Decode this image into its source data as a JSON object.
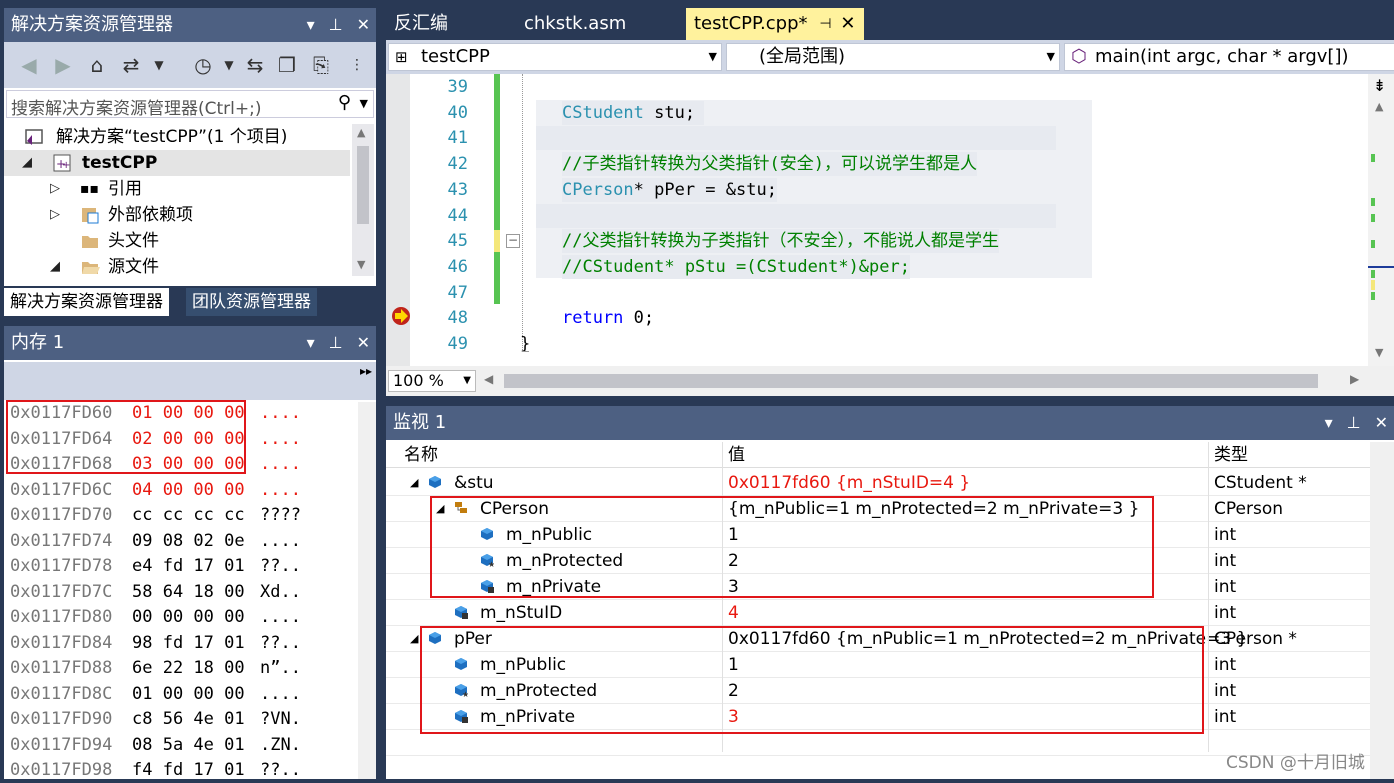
{
  "solution_explorer": {
    "title": "解决方案资源管理器",
    "search_placeholder": "搜索解决方案资源管理器(Ctrl+;)",
    "tree": {
      "solution": "解决方案“testCPP”(1 个项目)",
      "project": "testCPP",
      "references": "引用",
      "external_deps": "外部依赖项",
      "headers": "头文件",
      "sources": "源文件"
    },
    "bottom_tabs": [
      "解决方案资源管理器",
      "团队资源管理器"
    ]
  },
  "memory": {
    "title": "内存 1",
    "rows": [
      {
        "addr": "0x0117FD60",
        "bytes": "01 00 00 00",
        "ascii": "....",
        "changed": true
      },
      {
        "addr": "0x0117FD64",
        "bytes": "02 00 00 00",
        "ascii": "....",
        "changed": true
      },
      {
        "addr": "0x0117FD68",
        "bytes": "03 00 00 00",
        "ascii": "....",
        "changed": true
      },
      {
        "addr": "0x0117FD6C",
        "bytes": "04 00 00 00",
        "ascii": "....",
        "changed": true
      },
      {
        "addr": "0x0117FD70",
        "bytes": "cc cc cc cc",
        "ascii": "????",
        "changed": false
      },
      {
        "addr": "0x0117FD74",
        "bytes": "09 08 02 0e",
        "ascii": "....",
        "changed": false
      },
      {
        "addr": "0x0117FD78",
        "bytes": "e4 fd 17 01",
        "ascii": "??..",
        "changed": false
      },
      {
        "addr": "0x0117FD7C",
        "bytes": "58 64 18 00",
        "ascii": "Xd..",
        "changed": false
      },
      {
        "addr": "0x0117FD80",
        "bytes": "00 00 00 00",
        "ascii": "....",
        "changed": false
      },
      {
        "addr": "0x0117FD84",
        "bytes": "98 fd 17 01",
        "ascii": "??..",
        "changed": false
      },
      {
        "addr": "0x0117FD88",
        "bytes": "6e 22 18 00",
        "ascii": "n”..",
        "changed": false
      },
      {
        "addr": "0x0117FD8C",
        "bytes": "01 00 00 00",
        "ascii": "....",
        "changed": false
      },
      {
        "addr": "0x0117FD90",
        "bytes": "c8 56 4e 01",
        "ascii": "?VN.",
        "changed": false
      },
      {
        "addr": "0x0117FD94",
        "bytes": "08 5a 4e 01",
        "ascii": ".ZN.",
        "changed": false
      },
      {
        "addr": "0x0117FD98",
        "bytes": "f4 fd 17 01",
        "ascii": "??..",
        "changed": false
      }
    ]
  },
  "doc_tabs": [
    {
      "label": "反汇编",
      "active": false
    },
    {
      "label": "chkstk.asm",
      "active": false
    },
    {
      "label": "testCPP.cpp*",
      "active": true
    }
  ],
  "navbar": {
    "project": "testCPP",
    "scope": "(全局范围)",
    "function": "main(int argc, char * argv[])"
  },
  "editor": {
    "zoom": "100 %",
    "lines": [
      {
        "num": "39",
        "text": ""
      },
      {
        "num": "40",
        "text": "CStudent stu;"
      },
      {
        "num": "41",
        "text": ""
      },
      {
        "num": "42",
        "text": "//子类指针转换为父类指针(安全)，可以说学生都是人"
      },
      {
        "num": "43",
        "text": "CPerson* pPer = &stu;"
      },
      {
        "num": "44",
        "text": ""
      },
      {
        "num": "45",
        "text": "//父类指针转换为子类指针（不安全），不能说人都是学生"
      },
      {
        "num": "46",
        "text": "//CStudent* pStu =(CStudent*)&per;"
      },
      {
        "num": "47",
        "text": ""
      },
      {
        "num": "48",
        "text": "return 0;"
      },
      {
        "num": "49",
        "text": "}"
      }
    ],
    "tokens": {
      "l40_type": "CStudent",
      "l40_rest": " stu;",
      "l43_type": "CPerson",
      "l43_rest": "* pPer = &stu;",
      "l48_kw": "return",
      "l48_rest": " 0;"
    }
  },
  "watch": {
    "title": "监视 1",
    "headers": {
      "name": "名称",
      "value": "值",
      "type": "类型"
    },
    "rows": [
      {
        "name": "&stu",
        "value": "0x0117fd60 {m_nStuID=4 }",
        "type": "CStudent *",
        "red": true
      },
      {
        "name": "CPerson",
        "value": "{m_nPublic=1 m_nProtected=2 m_nPrivate=3 }",
        "type": "CPerson",
        "red": false
      },
      {
        "name": "m_nPublic",
        "value": "1",
        "type": "int",
        "red": false
      },
      {
        "name": "m_nProtected",
        "value": "2",
        "type": "int",
        "red": false
      },
      {
        "name": "m_nPrivate",
        "value": "3",
        "type": "int",
        "red": false
      },
      {
        "name": "m_nStuID",
        "value": "4",
        "type": "int",
        "red": true
      },
      {
        "name": "pPer",
        "value": "0x0117fd60 {m_nPublic=1 m_nProtected=2 m_nPrivate=3 }",
        "type": "CPerson *",
        "red": false
      },
      {
        "name": "m_nPublic",
        "value": "1",
        "type": "int",
        "red": false
      },
      {
        "name": "m_nProtected",
        "value": "2",
        "type": "int",
        "red": false
      },
      {
        "name": "m_nPrivate",
        "value": "3",
        "type": "int",
        "red": true
      }
    ]
  },
  "watermark": "CSDN @十月旧城",
  "colors": {
    "accent_red": "#e8180f",
    "tab_active": "#fff29d",
    "panel_bg": "#293955"
  }
}
